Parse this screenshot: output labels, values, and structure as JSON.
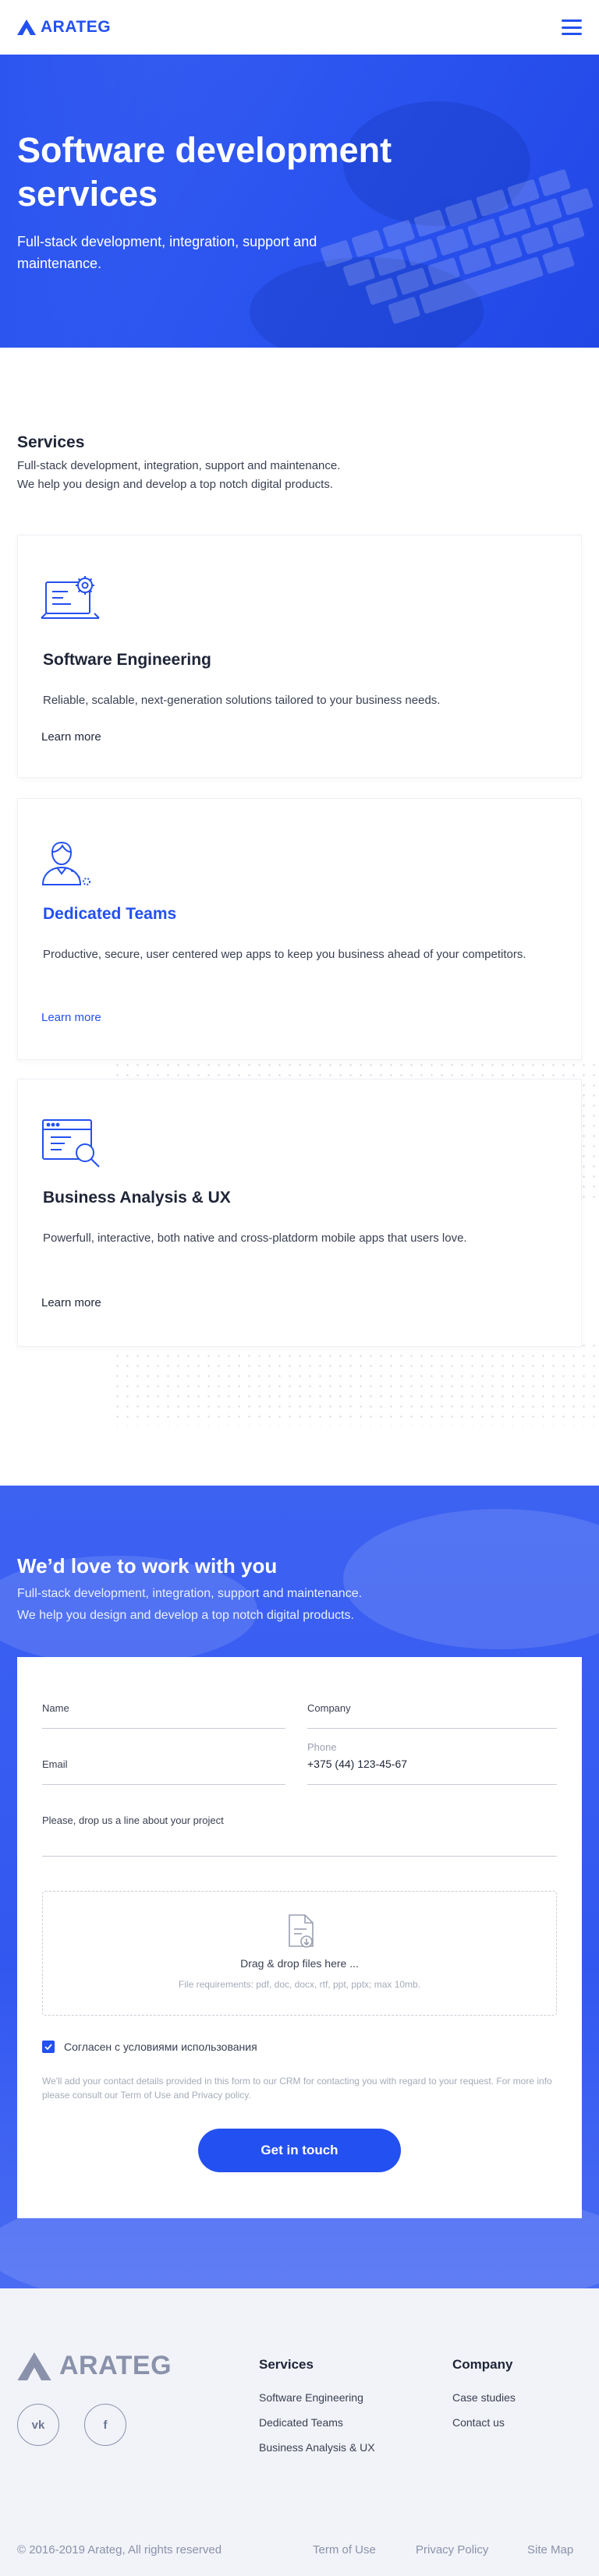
{
  "header": {
    "brand": "ARATEG",
    "menu_icon": "hamburger-menu-icon"
  },
  "hero": {
    "title": "Software development services",
    "subtitle": "Full-stack development, integration, support and maintenance."
  },
  "services": {
    "heading": "Services",
    "subtitle_line1": "Full-stack development, integration, support and maintenance.",
    "subtitle_line2": "We help you design and develop a top notch digital products.",
    "cards": [
      {
        "icon": "laptop-gear-icon",
        "title": "Software Engineering",
        "description": "Reliable, scalable, next-generation solutions tailored to your business needs.",
        "link": "Learn more"
      },
      {
        "icon": "team-person-icon",
        "title": "Dedicated Teams",
        "description": "Productive, secure, user centered wep apps to keep you business ahead of your competitors.",
        "link": "Learn more"
      },
      {
        "icon": "window-search-icon",
        "title": "Business Analysis & UX",
        "description": "Powerfull, interactive, both native and cross-platdorm mobile apps that users love.",
        "link": "Learn more"
      }
    ]
  },
  "contact": {
    "heading": "We’d love to work with you",
    "sub_line1": "Full-stack development, integration, support and maintenance.",
    "sub_line2": "We help you design and develop a top notch digital products.",
    "form": {
      "name_label": "Name",
      "company_label": "Company",
      "email_label": "Email",
      "phone_label": "Phone",
      "phone_value": "+375 (44) 123-45-67",
      "message_label": "Please, drop us a line about your project",
      "dropzone_title": "Drag & drop files here ...",
      "dropzone_requirements": "File requirements: pdf, doc, docx, rtf, ppt, pptx; max 10mb.",
      "agree_label": "Согласен с условиями использования",
      "agree_checked": true,
      "disclaimer": "We'll add your contact details provided in this form to our CRM for contacting you with regard to your request. For more info please consult our Term of Use and Privacy policy.",
      "submit_label": "Get in touch"
    }
  },
  "footer": {
    "brand": "ARATEG",
    "social": [
      {
        "icon": "vk-icon",
        "label": "vk"
      },
      {
        "icon": "facebook-icon",
        "label": "f"
      }
    ],
    "services_title": "Services",
    "services_links": [
      "Software Engineering",
      "Dedicated Teams",
      "Business Analysis & UX"
    ],
    "company_title": "Company",
    "company_links": [
      "Case studies",
      "Contact us"
    ],
    "copyright": "© 2016-2019 Arateg, All rights reserved",
    "bottom_links": [
      "Term of Use",
      "Privacy Policy",
      "Site Map"
    ]
  },
  "colors": {
    "accent": "#2350f0",
    "hero_bg": "#2c55f0",
    "footer_bg": "#f2f3f8",
    "text_dark": "#1f2538"
  }
}
